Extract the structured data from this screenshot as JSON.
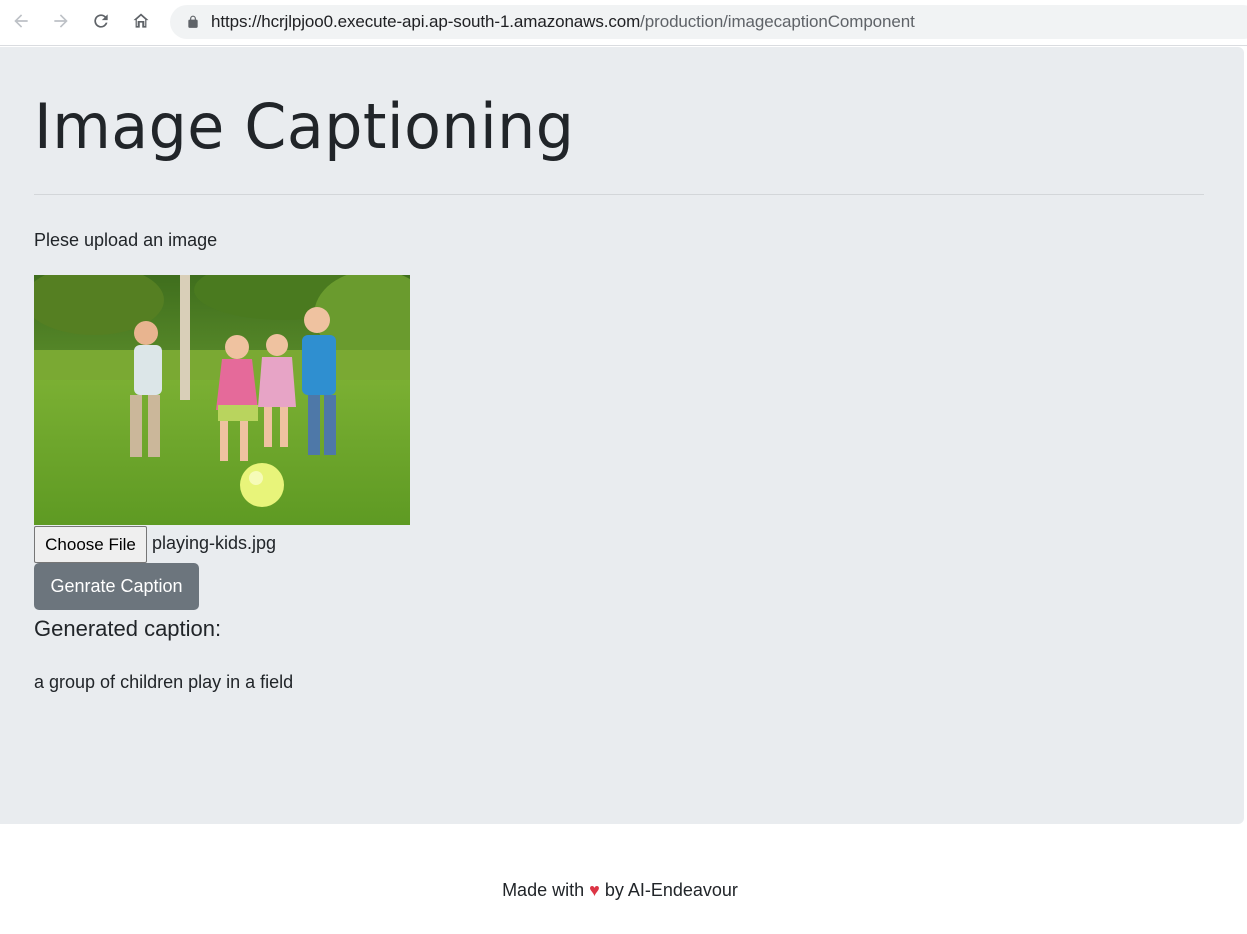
{
  "browser": {
    "url_host": "https://hcrjlpjoo0.execute-api.ap-south-1.amazonaws.com",
    "url_path": "/production/imagecaptionComponent",
    "icons": [
      "back-arrow-icon",
      "forward-arrow-icon",
      "reload-icon",
      "home-icon",
      "lock-icon"
    ]
  },
  "page": {
    "title": "Image Captioning",
    "upload_prompt": "Plese upload an image",
    "file_input": {
      "button_label": "Choose File",
      "file_name": "playing-kids.jpg"
    },
    "generate_button": "Genrate Caption",
    "caption_heading": "Generated caption:",
    "caption_text": "a group of children play in a field"
  },
  "footer": {
    "prefix": "Made with",
    "heart": "♥",
    "suffix": "by AI-Endeavour"
  },
  "colors": {
    "jumbotron_bg": "#e9ecef",
    "button_bg": "#6c757d",
    "heart": "#dc3545"
  }
}
